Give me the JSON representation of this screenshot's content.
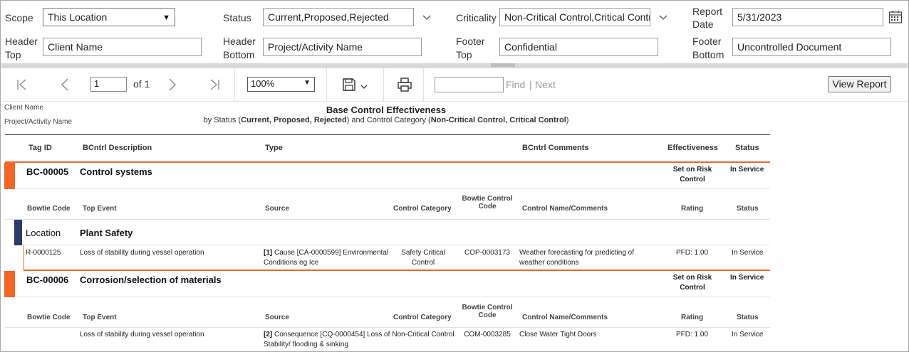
{
  "params": {
    "scope_label": "Scope",
    "scope_value": "This Location",
    "status_label": "Status",
    "status_value": "Current,Proposed,Rejected",
    "criticality_label": "Criticality",
    "criticality_value": "Non-Critical Control,Critical Contro",
    "report_date_label_1": "Report",
    "report_date_label_2": "Date",
    "report_date_value": "5/31/2023",
    "header_top_label_1": "Header",
    "header_top_label_2": "Top",
    "header_top_value": "Client Name",
    "header_bottom_label_1": "Header",
    "header_bottom_label_2": "Bottom",
    "header_bottom_value": "Project/Activity Name",
    "footer_top_label_1": "Footer",
    "footer_top_label_2": "Top",
    "footer_top_value": "Confidential",
    "footer_bottom_label_1": "Footer",
    "footer_bottom_label_2": "Bottom",
    "footer_bottom_value": "Uncontrolled Document"
  },
  "toolbar": {
    "page_value": "1",
    "of_text": "of 1",
    "zoom_value": "100%",
    "find_label": "Find",
    "separator": "|",
    "next_label": "Next",
    "view_report_label": "View Report"
  },
  "report": {
    "client_name": "Client Name",
    "project_name": "Project/Activity Name",
    "title": "Base Control Effectiveness",
    "subtitle_prefix": "by Status (",
    "subtitle_status": "Current, Proposed, Rejected",
    "subtitle_mid": ") and  Control Category (",
    "subtitle_category": "Non-Critical Control, Critical Control",
    "subtitle_suffix": ")",
    "main_headers": {
      "tag_id": "Tag ID",
      "description": "BCntrl Description",
      "type": "Type",
      "comments": "BCntrl Comments",
      "effectiveness": "Effectiveness",
      "status": "Status"
    },
    "sub_headers": {
      "bowtie_code": "Bowtie Code",
      "top_event": "Top Event",
      "source": "Source",
      "control_category": "Control Category",
      "bowtie_control_code_1": "Bowtie Control",
      "bowtie_control_code_2": "Code",
      "control_name": "Control Name/Comments",
      "rating": "Rating",
      "status": "Status"
    },
    "controls": [
      {
        "tag": "BC-00005",
        "description": "Control systems",
        "effectiveness_1": "Set on Risk",
        "effectiveness_2": "Control",
        "status": "In Service",
        "location_label": "Location",
        "location_value": "Plant Safety",
        "row": {
          "bowtie_code": "R-0000125",
          "top_event": "Loss of stability during vessel operation",
          "source_num": "[1]",
          "source_1": " Cause [CA-0000599] Environmental",
          "source_2": "Conditions eg Ice",
          "category_1": "Safety Critical",
          "category_2": "Control",
          "control_code": "COP-0003173",
          "control_name_1": "Weather forecasting for predicting of",
          "control_name_2": "weather conditions",
          "rating": "PFD: 1.00",
          "status": "In Service"
        }
      },
      {
        "tag": "BC-00006",
        "description": "Corrosion/selection of materials",
        "effectiveness_1": "Set on Risk",
        "effectiveness_2": "Control",
        "status": "In Service",
        "row": {
          "bowtie_code": "",
          "top_event": "Loss of stability during vessel operation",
          "source_num": "[2]",
          "source_1": " Consequence [CQ-0000454] Loss of",
          "source_2": "Stability/ flooding & sinking",
          "category_1": "Non-Critical Control",
          "category_2": "",
          "control_code": "COM-0003285",
          "control_name_1": "Close Water Tight Doors",
          "control_name_2": "",
          "rating": "PFD: 1.00",
          "status": "In Service"
        }
      }
    ]
  }
}
